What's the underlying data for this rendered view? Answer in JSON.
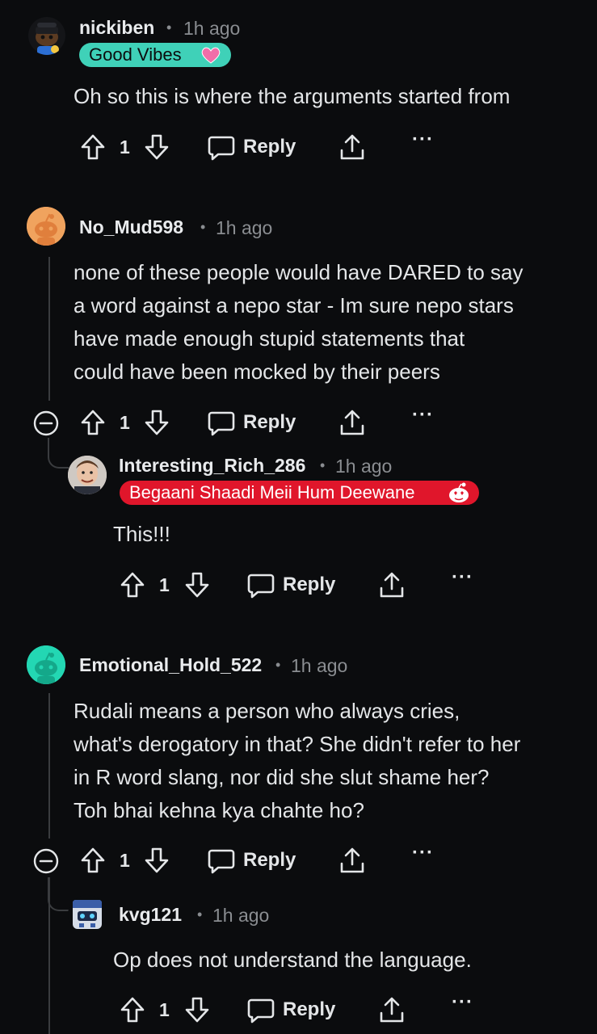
{
  "comments": [
    {
      "username": "nickiben",
      "time": "1h ago",
      "flair": "Good Vibes",
      "body": "Oh so this is where the arguments started from",
      "votes": "1",
      "reply_label": "Reply"
    },
    {
      "username": "No_Mud598",
      "time": "1h ago",
      "body_lines": [
        "none of these people would have DARED to say",
        "a word against a nepo star - Im sure nepo stars",
        "have made enough stupid statements that",
        "could have been mocked by their peers"
      ],
      "votes": "1",
      "reply_label": "Reply"
    },
    {
      "username": "Interesting_Rich_286",
      "time": "1h ago",
      "flair": "Begaani Shaadi Meii Hum Deewane",
      "body": "This!!!",
      "votes": "1",
      "reply_label": "Reply"
    },
    {
      "username": "Emotional_Hold_522",
      "time": "1h ago",
      "body_lines": [
        "Rudali means a person who always cries,",
        "what's derogatory in that? She didn't refer to her",
        "in R word slang, nor did she slut shame her?",
        "Toh bhai kehna kya chahte ho?"
      ],
      "votes": "1",
      "reply_label": "Reply"
    },
    {
      "username": "kvg121",
      "time": "1h ago",
      "body": "Op does not understand the language.",
      "votes": "1",
      "reply_label": "Reply"
    }
  ],
  "colors": {
    "background": "#0b0c0e",
    "good_vibes_flair": "#3fd1b8",
    "begaani_flair": "#e0162b",
    "no_mud_avatar": "#f0a35e",
    "emotional_avatar": "#23d7b3"
  },
  "icons": [
    "upvote-icon",
    "downvote-icon",
    "reply-bubble-icon",
    "share-icon",
    "more-icon",
    "collapse-icon",
    "heart-icon",
    "heart-eyes-snoo-icon"
  ]
}
